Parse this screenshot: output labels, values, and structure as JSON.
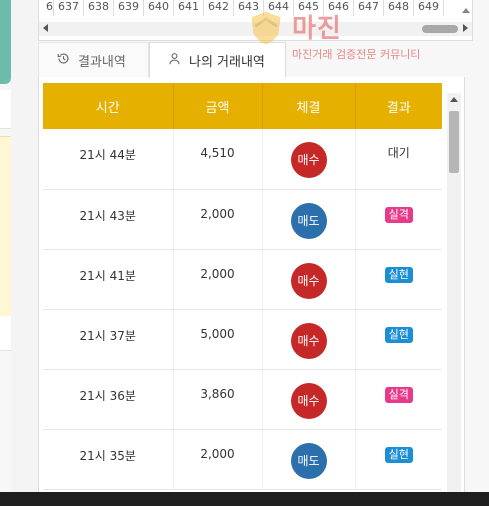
{
  "ticker": {
    "numbers": [
      "6",
      "637",
      "638",
      "639",
      "640",
      "641",
      "642",
      "643",
      "644",
      "645",
      "646",
      "647",
      "648",
      "649"
    ]
  },
  "tabs": {
    "history_label": "결과내역",
    "my_trades_label": "나의 거래내역"
  },
  "table": {
    "headers": [
      "시간",
      "금액",
      "체결",
      "결과"
    ],
    "rows": [
      {
        "time": "21시 44분",
        "amount": "4,510",
        "trade": "매수",
        "result": "대기"
      },
      {
        "time": "21시 43분",
        "amount": "2,000",
        "trade": "매도",
        "result": "실격"
      },
      {
        "time": "21시 41분",
        "amount": "2,000",
        "trade": "매수",
        "result": "실현"
      },
      {
        "time": "21시 37분",
        "amount": "5,000",
        "trade": "매수",
        "result": "실현"
      },
      {
        "time": "21시 36분",
        "amount": "3,860",
        "trade": "매수",
        "result": "실격"
      },
      {
        "time": "21시 35분",
        "amount": "2,000",
        "trade": "매도",
        "result": "실현"
      }
    ]
  },
  "watermark": {
    "title": "마진",
    "subtitle": "마진거래 검증전문 커뮤니티"
  },
  "colors": {
    "header_bg": "#e5b000",
    "buy": "#c62828",
    "sell": "#2c6fad",
    "loss_badge": "#e83a8a",
    "gain_badge": "#1c8ed6"
  }
}
